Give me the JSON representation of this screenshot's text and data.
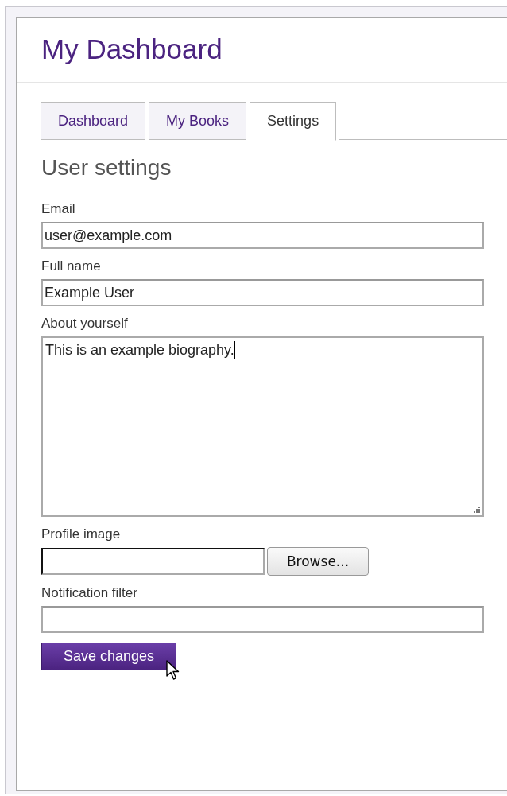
{
  "title": "My Dashboard",
  "tabs": [
    {
      "label": "Dashboard",
      "selected": false
    },
    {
      "label": "My Books",
      "selected": false
    },
    {
      "label": "Settings",
      "selected": true
    }
  ],
  "heading": "User settings",
  "fields": [
    {
      "kind": "text",
      "label": "Email",
      "value": "user@example.com"
    },
    {
      "kind": "text",
      "label": "Full name",
      "value": "Example User"
    },
    {
      "kind": "textarea",
      "label": "About yourself",
      "value": "This is an example biography."
    },
    {
      "kind": "file",
      "label": "Profile image",
      "button": "Browse..."
    },
    {
      "kind": "text",
      "label": "Notification filter"
    }
  ],
  "submit": "Save changes"
}
